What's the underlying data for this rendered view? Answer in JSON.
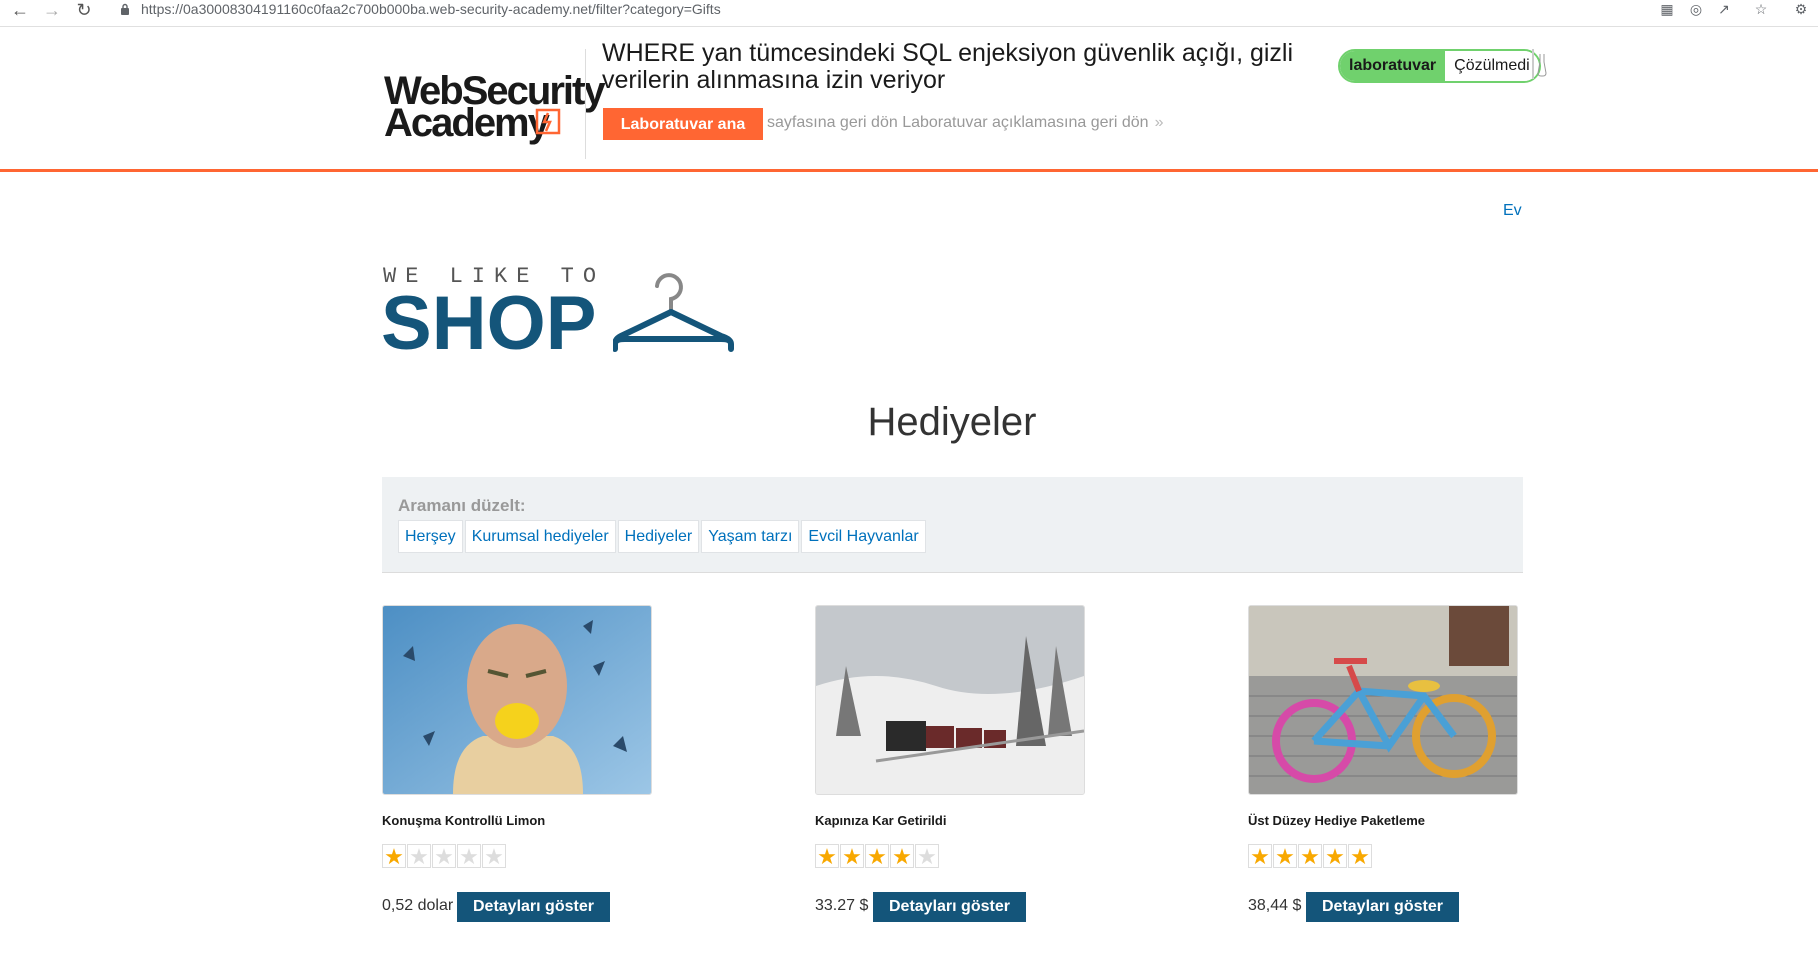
{
  "browser": {
    "url": "https://0a30008304191160c0faa2c700b000ba.web-security-academy.net/filter?category=Gifts",
    "back_icon": "arrow-left-icon",
    "forward_icon": "arrow-right-icon",
    "reload_icon": "reload-icon"
  },
  "academy": {
    "logo_line1": "WebSecurity",
    "logo_line2": "Academy",
    "lab_title": "WHERE yan tümcesindeki SQL enjeksiyon güvenlik açığı, gizli verilerin alınmasına izin veriyor",
    "lab_button": "Laboratuvar ana",
    "back_text": "sayfasına geri dön Laboratuvar açıklamasına geri dön",
    "back_chevron": "»",
    "status_label": "laboratuvar",
    "status_value": "Çözülmedi",
    "accent_color": "#ff6633",
    "status_color": "#70d16d"
  },
  "shop": {
    "home_link": "Ev",
    "logo_tagline": "WE LIKE TO",
    "logo_word": "SHOP",
    "page_title": "Hediyeler",
    "filter_label": "Aramanı düzelt:",
    "filters": [
      "Herşey",
      "Kurumsal hediyeler",
      "Hediyeler",
      "Yaşam tarzı",
      "Evcil Hayvanlar"
    ],
    "brand_color": "#14557a",
    "link_color": "#0071bc",
    "star_color": "#f8a800"
  },
  "products": [
    {
      "name": "Konuşma Kontrollü Limon",
      "rating": 1,
      "price": "0,52 dolar",
      "button": "Detayları göster"
    },
    {
      "name": "Kapınıza Kar Getirildi",
      "rating": 4,
      "price": "33.27 $",
      "button": "Detayları göster"
    },
    {
      "name": "Üst Düzey Hediye Paketleme",
      "rating": 5,
      "price": "38,44 $",
      "button": "Detayları göster"
    }
  ]
}
